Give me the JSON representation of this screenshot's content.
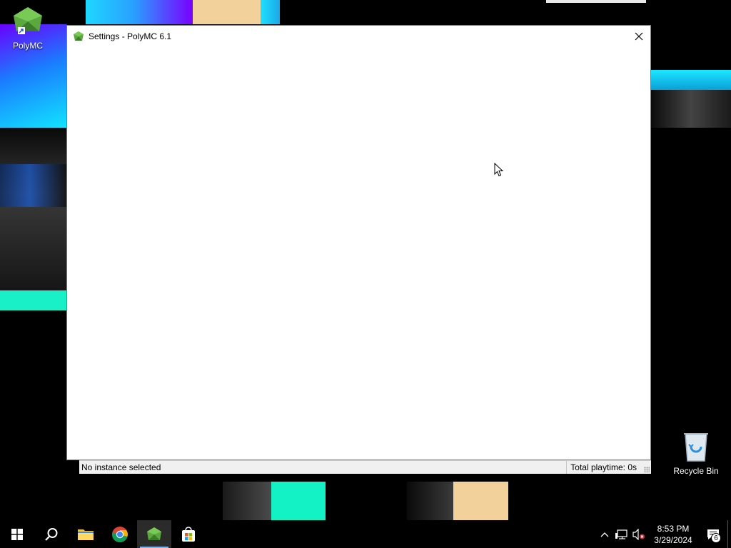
{
  "desktop": {
    "icons": [
      {
        "label": "PolyMC",
        "icon": "polymc-icon"
      },
      {
        "label": "Recycle Bin",
        "icon": "recycle-bin-icon"
      }
    ]
  },
  "window": {
    "title": "Settings - PolyMC 6.1",
    "close_glyph": "✕"
  },
  "statusbar": {
    "left_text": "No instance selected",
    "right_text": "Total playtime: 0s"
  },
  "taskbar": {
    "items": [
      {
        "name": "start",
        "icon": "windows-logo-icon"
      },
      {
        "name": "search",
        "icon": "search-icon"
      },
      {
        "name": "file-explorer",
        "icon": "folder-icon"
      },
      {
        "name": "chrome",
        "icon": "chrome-icon"
      },
      {
        "name": "polymc",
        "icon": "polymc-icon",
        "active": true
      },
      {
        "name": "store",
        "icon": "store-icon"
      }
    ],
    "tray": {
      "time": "8:53 PM",
      "date": "3/29/2024",
      "notification_count": "6"
    }
  },
  "colors": {
    "accent": "#7fb2e6",
    "polymc_green": "#4f9a3a"
  }
}
